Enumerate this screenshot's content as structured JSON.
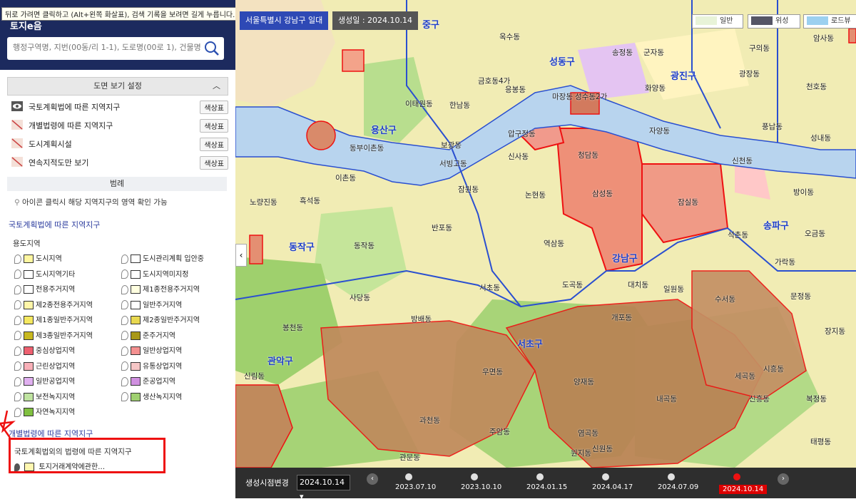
{
  "tooltip": "뒤로 가려면 클릭하고 (Alt+왼쪽 화살표), 검색 기록을 보려면 길게 누릅니다.",
  "brand": {
    "logo": "토지e음"
  },
  "search": {
    "placeholder": "행정구역명, 지번(00동/리 1-1), 도로명(00로 1), 건물명 입력"
  },
  "settings": {
    "title": "도면 보기 설정"
  },
  "layers": [
    {
      "label": "국토계획법에 따른 지역지구",
      "button": "색상표",
      "icon": "eye-icon"
    },
    {
      "label": "개별법령에 따른 지역지구",
      "button": "색상표",
      "icon": "hidden-icon"
    },
    {
      "label": "도시계획시설",
      "button": "색상표",
      "icon": "hidden-icon"
    },
    {
      "label": "연속지적도만 보기",
      "button": "색상표",
      "icon": "hidden-icon"
    }
  ],
  "legend": {
    "title": "범례",
    "hint": "아이콘 클릭시 해당 지역지구의 영역 확인 가능",
    "section1": "국토계획법에 따른 지역지구",
    "subsection1": "용도지역",
    "items": [
      {
        "label": "도시지역",
        "color": "#fff6a0"
      },
      {
        "label": "도시관리계획 입안중",
        "color": "#ffffff"
      },
      {
        "label": "도시지역기타",
        "color": "#ffffff"
      },
      {
        "label": "도시지역미지정",
        "color": "#ffffff"
      },
      {
        "label": "전용주거지역",
        "color": "#ffffff"
      },
      {
        "label": "제1종전용주거지역",
        "color": "#ffffe0"
      },
      {
        "label": "제2종전용주거지역",
        "color": "#fff5a8"
      },
      {
        "label": "일반주거지역",
        "color": "#ffffff"
      },
      {
        "label": "제1종일반주거지역",
        "color": "#f5e860"
      },
      {
        "label": "제2종일반주거지역",
        "color": "#e8d850"
      },
      {
        "label": "제3종일반주거지역",
        "color": "#c8b820"
      },
      {
        "label": "준주거지역",
        "color": "#a89818"
      },
      {
        "label": "중심상업지역",
        "color": "#ee6070"
      },
      {
        "label": "일반상업지역",
        "color": "#f49090"
      },
      {
        "label": "근린상업지역",
        "color": "#f8b0b8"
      },
      {
        "label": "유통상업지역",
        "color": "#f6c6c6"
      },
      {
        "label": "일반공업지역",
        "color": "#e0b0f0"
      },
      {
        "label": "준공업지역",
        "color": "#d090e0"
      },
      {
        "label": "보전녹지지역",
        "color": "#bfe3a0"
      },
      {
        "label": "생산녹지지역",
        "color": "#9fd070"
      },
      {
        "label": "자연녹지지역",
        "color": "#80c040"
      }
    ],
    "section2": "개별법령에 따른 지역지구",
    "subsection2": "국토계획법외의 법령에 따른 지역지구",
    "land_item": "토지거래계약에관한…"
  },
  "map": {
    "area_tag": "서울특별시 강남구 일대",
    "date_tag": "생성일 : 2024.10.14",
    "maptypes": [
      "일반",
      "위성",
      "로드뷰"
    ],
    "districts": [
      "용산구",
      "동작구",
      "관악구",
      "서초구",
      "강남구",
      "송파구",
      "광진구",
      "성동구",
      "중구"
    ],
    "dongs": [
      "이태원동",
      "한남동",
      "보광동",
      "서빙고동",
      "이촌동",
      "동부이촌동",
      "반포동",
      "잠원동",
      "신사동",
      "압구정동",
      "논현동",
      "청담동",
      "삼성동",
      "잠실동",
      "역삼동",
      "도곡동",
      "대치동",
      "개포동",
      "일원동",
      "수서동",
      "서초동",
      "방배동",
      "사당동",
      "우면동",
      "양재동",
      "내곡동",
      "원지동",
      "신원동",
      "염곡동",
      "세곡동",
      "과천동",
      "주암동",
      "관문동",
      "봉천동",
      "신림동",
      "노량진동",
      "흑석동",
      "동작동",
      "성수동2가",
      "송정동",
      "군자동",
      "화양동",
      "자양동",
      "구의동",
      "광장동",
      "천호동",
      "풍납동",
      "성내동",
      "신천동",
      "방이동",
      "석촌동",
      "가락동",
      "오금동",
      "문정동",
      "장지동",
      "신흥동",
      "복정동",
      "태평동",
      "시흥동",
      "수진동",
      "암사동",
      "금호동4가",
      "옥수동",
      "응봉동",
      "마장동"
    ]
  },
  "timeline": {
    "label": "생성시점변경",
    "select": "2024.10.14",
    "dates": [
      "2023.07.10",
      "2023.10.10",
      "2024.01.15",
      "2024.04.17",
      "2024.07.09"
    ],
    "current": "2024.10.14"
  }
}
